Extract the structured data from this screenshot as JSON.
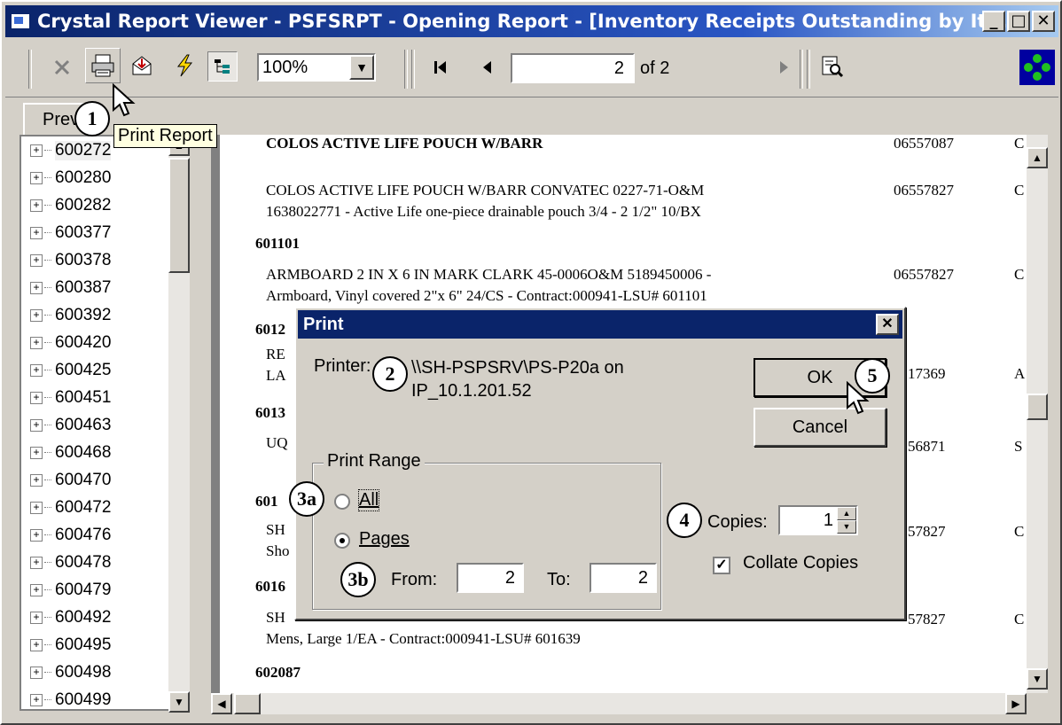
{
  "window": {
    "title": "Crystal Report Viewer - PSFSRPT - Opening Report - [Inventory Receipts Outstanding by It...",
    "controls": [
      "_",
      "□",
      "✕"
    ]
  },
  "toolbar": {
    "zoom_value": "100%",
    "page_current": "2",
    "page_total_text": "of 2",
    "tooltip": "Print Report"
  },
  "tabs": {
    "preview": "Prev"
  },
  "tree": {
    "items": [
      "600272",
      "600280",
      "600282",
      "600377",
      "600378",
      "600387",
      "600392",
      "600420",
      "600425",
      "600451",
      "600463",
      "600468",
      "600470",
      "600472",
      "600476",
      "600478",
      "600479",
      "600492",
      "600495",
      "600498",
      "600499"
    ]
  },
  "report": {
    "lines": [
      "COLOS ACTIVE LIFE POUCH W/BARR",
      "06557087",
      "COLOS ACTIVE LIFE POUCH W/BARR CONVATEC 0227-71-O&M",
      "06557827",
      "1638022771 - Active Life one-piece drainable pouch 3/4 - 2 1/2\" 10/BX",
      "601101",
      "ARMBOARD 2 IN X 6 IN MARK CLARK 45-0006O&M 5189450006 -",
      "06557827",
      "Armboard, Vinyl covered 2\"x 6\" 24/CS - Contract:000941-LSU# 601101",
      "6012",
      "RE",
      "LA",
      "17369",
      "6013",
      "UQ",
      "56871",
      "601",
      "SH",
      "Sho",
      "57827",
      "6016",
      "SH",
      "57827",
      "Mens, Large 1/EA - Contract:000941-LSU# 601639",
      "602087"
    ],
    "edge_chars": [
      "C",
      "C",
      "C",
      "A",
      "S",
      "C",
      "C"
    ]
  },
  "print_dialog": {
    "title": "Print",
    "printer_label": "Printer:",
    "printer_value_line1": "\\\\SH-PSPSRV\\PS-P20a on",
    "printer_value_line2": "IP_10.1.201.52",
    "ok_label": "OK",
    "cancel_label": "Cancel",
    "range_label": "Print Range",
    "all_label": "All",
    "pages_label": "Pages",
    "from_label": "From:",
    "from_value": "2",
    "to_label": "To:",
    "to_value": "2",
    "copies_label": "Copies:",
    "copies_value": "1",
    "collate_label": "Collate Copies",
    "collate_checked": true
  },
  "callouts": [
    "1",
    "2",
    "3a",
    "3b",
    "4",
    "5"
  ]
}
